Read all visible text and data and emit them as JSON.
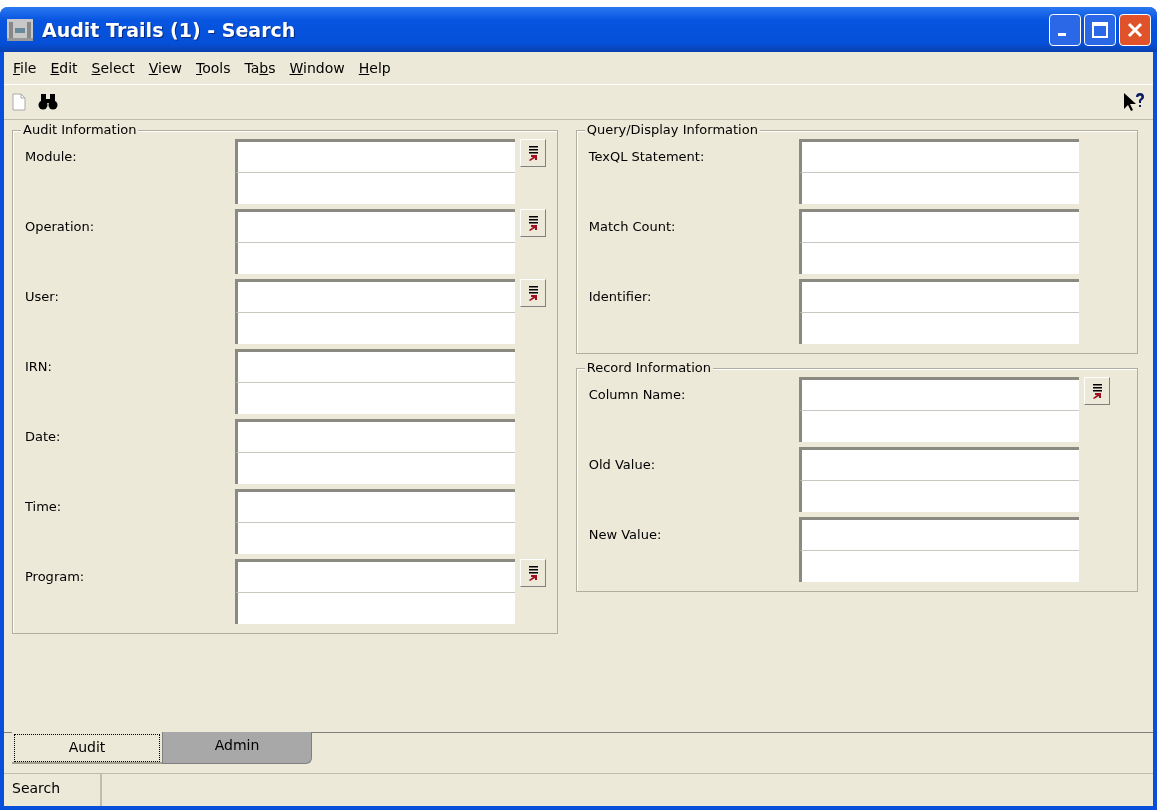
{
  "window": {
    "title": "Audit Trails (1) - Search"
  },
  "menu": [
    {
      "key": "F",
      "post": "ile"
    },
    {
      "key": "E",
      "post": "dit"
    },
    {
      "key": "S",
      "post": "elect"
    },
    {
      "key": "V",
      "post": "iew"
    },
    {
      "key": "T",
      "post": "ools"
    },
    {
      "pre": "Ta",
      "key": "b",
      "post": "s"
    },
    {
      "key": "W",
      "post": "indow"
    },
    {
      "key": "H",
      "post": "elp"
    }
  ],
  "columns": [
    {
      "groups": [
        {
          "title": "Audit Information",
          "fields": [
            {
              "label": "Module:",
              "lookup": true
            },
            {
              "label": "Operation:",
              "lookup": true
            },
            {
              "label": "User:",
              "lookup": true
            },
            {
              "label": "IRN:",
              "lookup": false
            },
            {
              "label": "Date:",
              "lookup": false
            },
            {
              "label": "Time:",
              "lookup": false
            },
            {
              "label": "Program:",
              "lookup": true
            }
          ]
        }
      ]
    },
    {
      "groups": [
        {
          "title": "Query/Display Information",
          "fields": [
            {
              "label": "TexQL Statement:",
              "lookup": false
            },
            {
              "label": "Match Count:",
              "lookup": false
            },
            {
              "label": "Identifier:",
              "lookup": false
            }
          ]
        },
        {
          "title": "Record Information",
          "fields": [
            {
              "label": "Column Name:",
              "lookup": true
            },
            {
              "label": "Old Value:",
              "lookup": false
            },
            {
              "label": "New Value:",
              "lookup": false
            }
          ]
        }
      ]
    }
  ],
  "tabs": [
    {
      "label": "Audit",
      "selected": true
    },
    {
      "label": "Admin",
      "selected": false
    }
  ],
  "status_bar": {
    "text": "Search"
  }
}
